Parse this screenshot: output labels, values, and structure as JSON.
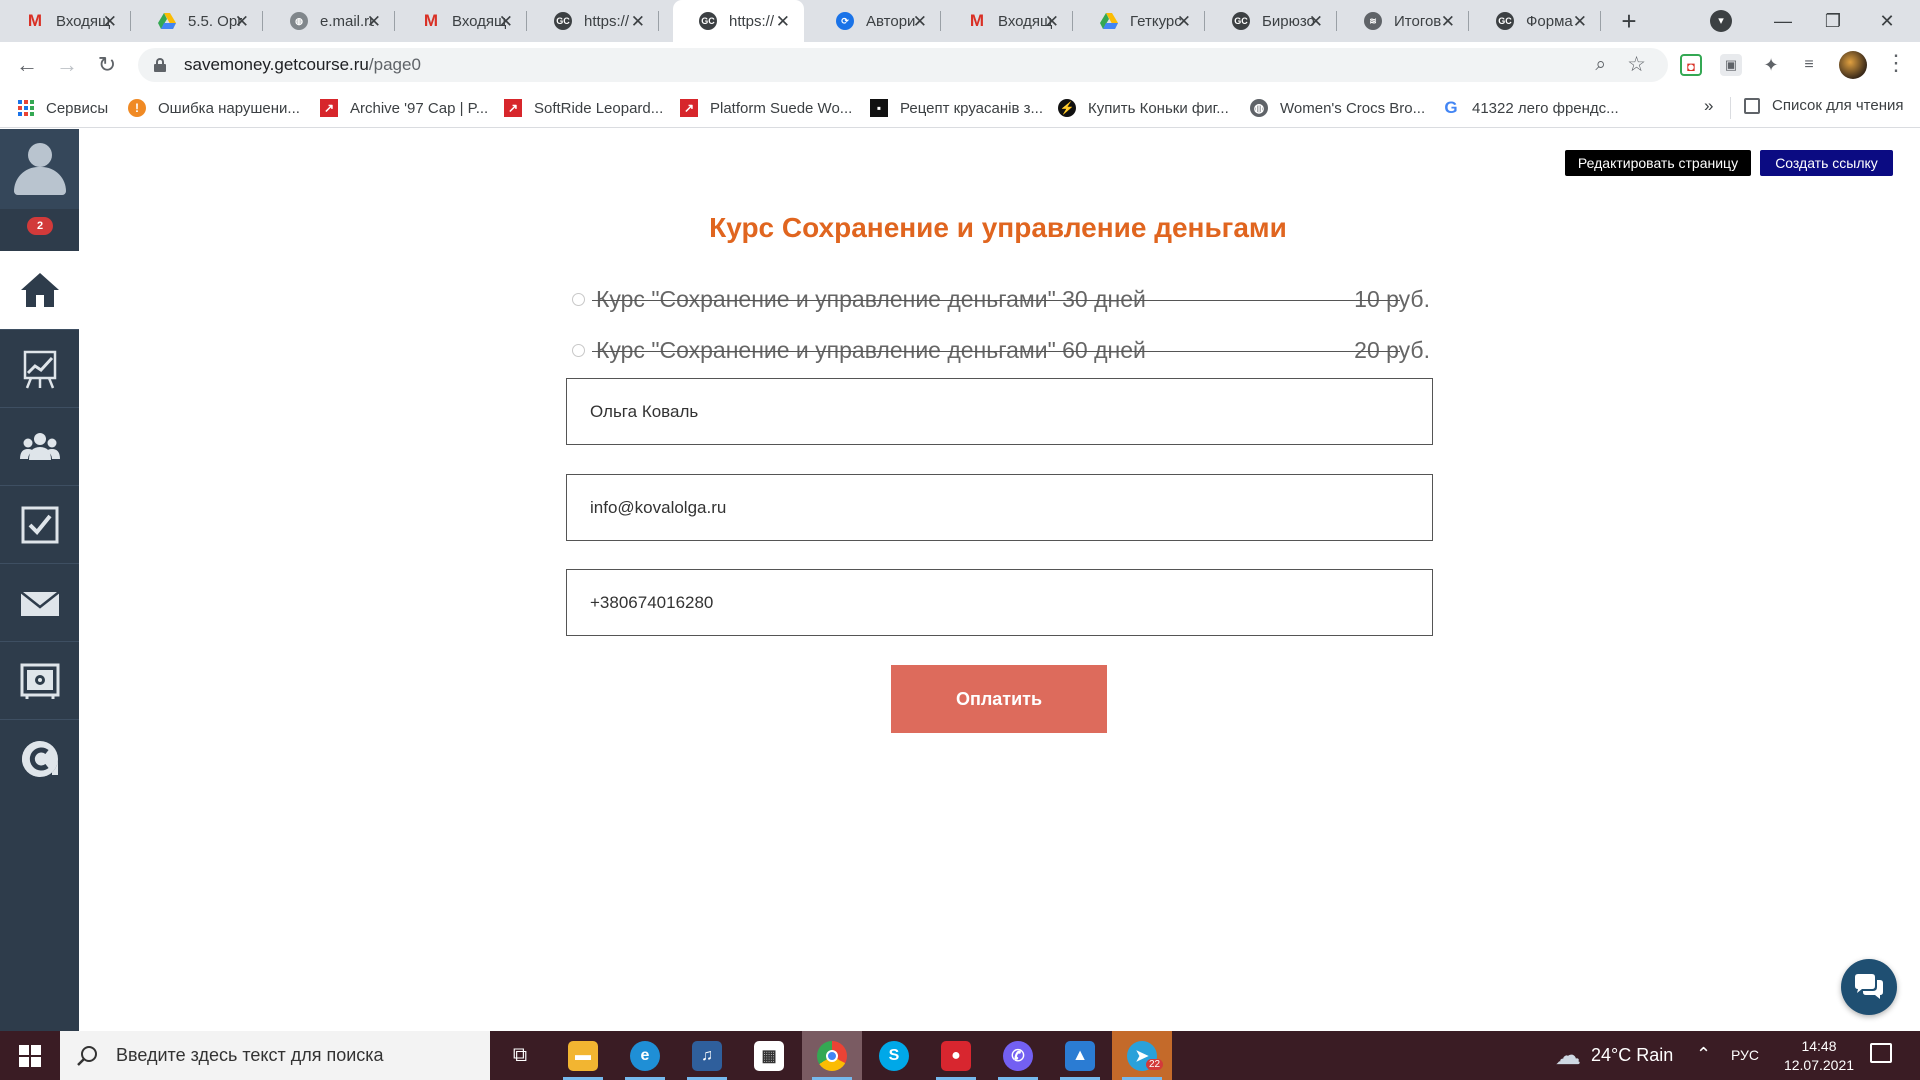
{
  "browser": {
    "tabs": [
      {
        "icon": "gmail-icon",
        "title": "Входящ"
      },
      {
        "icon": "google-drive-icon",
        "title": "5.5. Орг"
      },
      {
        "icon": "globe-icon",
        "title": "e.mail.ru"
      },
      {
        "icon": "gmail-icon",
        "title": "Входящ"
      },
      {
        "icon": "getcourse-icon",
        "title": "https://"
      },
      {
        "icon": "getcourse-icon",
        "title": "https://"
      },
      {
        "icon": "sync-icon",
        "title": "Автори"
      },
      {
        "icon": "gmail-icon",
        "title": "Входящ"
      },
      {
        "icon": "google-drive-icon",
        "title": "Геткурс"
      },
      {
        "icon": "getcourse-icon",
        "title": "Бирюзо"
      },
      {
        "icon": "stats-icon",
        "title": "Итогов"
      },
      {
        "icon": "getcourse-icon",
        "title": "Форма"
      }
    ],
    "active_tab_index": 5,
    "url": {
      "host": "savemoney.getcourse.ru",
      "path": "/page0"
    },
    "bookmarks": [
      {
        "icon": "apps-icon",
        "label": "Сервисы"
      },
      {
        "icon": "error-icon",
        "label": "Ошибка нарушени..."
      },
      {
        "icon": "puma-icon",
        "label": "Archive '97 Cap | P..."
      },
      {
        "icon": "puma-icon",
        "label": "SoftRide Leopard..."
      },
      {
        "icon": "puma-icon",
        "label": "Platform Suede Wo..."
      },
      {
        "icon": "recipe-icon",
        "label": "Рецепт круасанів з..."
      },
      {
        "icon": "skate-icon",
        "label": "Купить Коньки фиг..."
      },
      {
        "icon": "globe-icon",
        "label": "Women's Crocs Bro..."
      },
      {
        "icon": "google-icon",
        "label": "41322 лего френдс..."
      }
    ],
    "bookmarks_more": "»",
    "reading_list_label": "Список для чтения"
  },
  "sidebar": {
    "notification_count": "2",
    "items": [
      "home-icon",
      "chart-icon",
      "users-icon",
      "tasks-icon",
      "mail-icon",
      "safe-icon",
      "getcourse-logo-icon"
    ]
  },
  "page": {
    "edit_page_label": "Редактировать страницу",
    "create_link_label": "Создать ссылку",
    "title": "Курс Сохранение и управление деньгами",
    "offers": [
      {
        "name": "Курс \"Сохранение и управление деньгами\" 30 дней",
        "price": "10 руб."
      },
      {
        "name": "Курс \"Сохранение и управление деньгами\" 60 дней",
        "price": "20 руб."
      }
    ],
    "form": {
      "name_value": "Ольга Коваль",
      "email_value": "info@kovalolga.ru",
      "phone_value": "+380674016280"
    },
    "pay_label": "Оплатить"
  },
  "taskbar": {
    "search_placeholder": "Введите здесь текст для поиска",
    "apps": [
      "task-view-icon",
      "file-explorer-icon",
      "edge-icon",
      "media-player-icon",
      "store-icon",
      "chrome-icon",
      "skype-icon",
      "recorder-icon",
      "viber-icon",
      "photos-icon",
      "telegram-icon"
    ],
    "telegram_badge": "22",
    "weather": "24°C Rain",
    "language": "РУС",
    "time": "14:48",
    "date": "12.07.2021"
  },
  "colors": {
    "title_orange": "#e0651f",
    "pay_button": "#dd6b5c",
    "sidebar_bg": "#2e3c4b",
    "create_link_bg": "#0b0b82",
    "taskbar_bg": "#3a1c24"
  }
}
